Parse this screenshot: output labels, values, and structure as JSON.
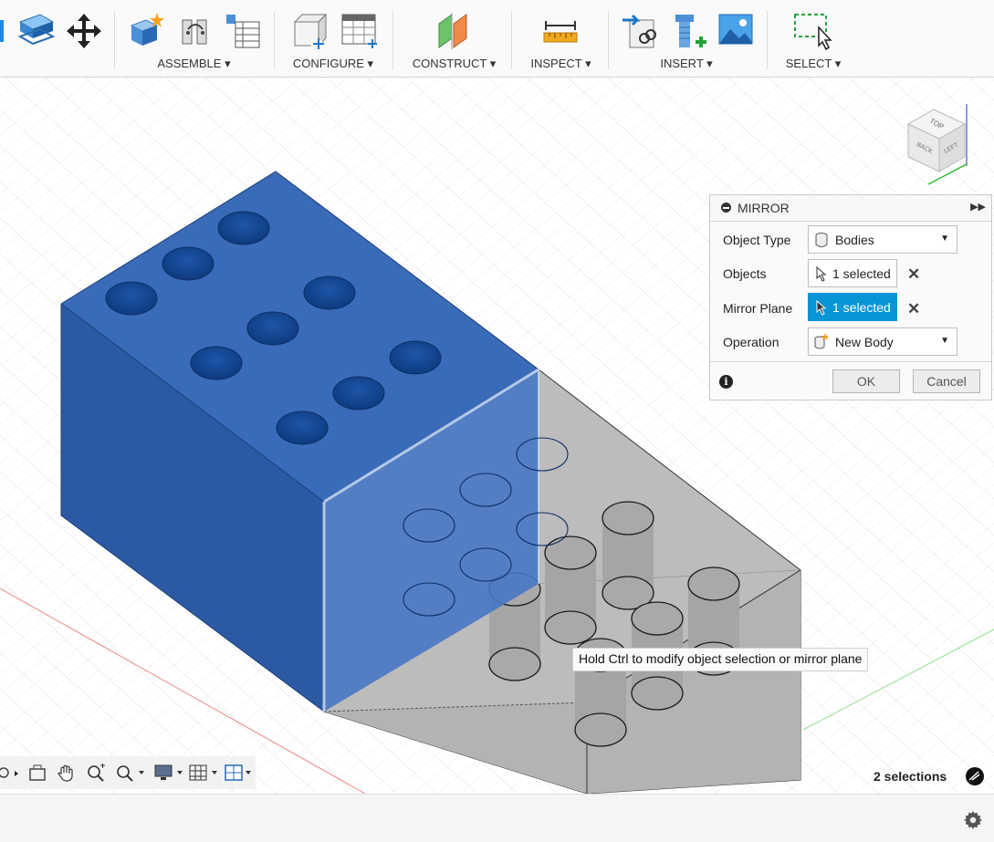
{
  "toolbar": {
    "groups": [
      {
        "label": "ASSEMBLE ▾"
      },
      {
        "label": "CONFIGURE ▾"
      },
      {
        "label": "CONSTRUCT ▾"
      },
      {
        "label": "INSPECT ▾"
      },
      {
        "label": "INSERT ▾"
      },
      {
        "label": "SELECT ▾"
      }
    ]
  },
  "mirror_panel": {
    "title": "MIRROR",
    "rows": [
      {
        "label": "Object Type",
        "value": "Bodies"
      },
      {
        "label": "Objects",
        "value": "1 selected"
      },
      {
        "label": "Mirror Plane",
        "value": "1 selected"
      },
      {
        "label": "Operation",
        "value": "New Body"
      }
    ],
    "ok_label": "OK",
    "cancel_label": "Cancel"
  },
  "viewcube": {
    "top": "TOP",
    "front": "BACK",
    "right": "LEFT"
  },
  "tooltip": "Hold Ctrl to modify object selection or mirror plane",
  "status": {
    "selections": "2 selections"
  },
  "colors": {
    "body_blue": "#2f5fa8",
    "accent": "#0696d7",
    "ghost": "#b9b9b9"
  }
}
